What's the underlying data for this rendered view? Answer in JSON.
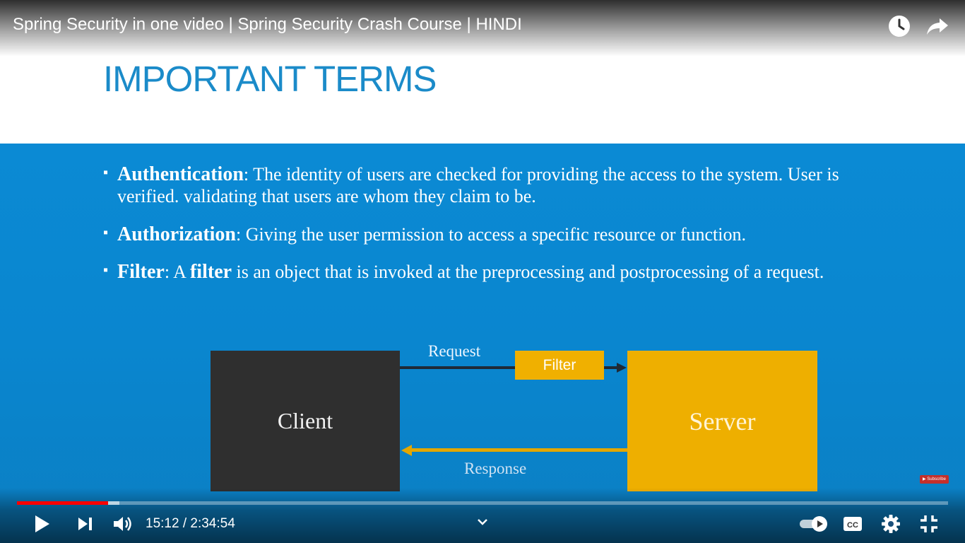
{
  "video": {
    "title": "Spring Security in one video | Spring Security Crash Course | HINDI"
  },
  "slide": {
    "title": "IMPORTANT TERMS",
    "bullets": [
      {
        "term": "Authentication",
        "text": ": The identity of users are checked for providing the access to the system. User is verified.  validating that users are whom they claim to be."
      },
      {
        "term": "Authorization",
        "text": ": Giving the user permission to access a specific resource or function."
      },
      {
        "term": "Filter",
        "text_pre": ": A ",
        "term2": "filter",
        "text": " is an object that is invoked at the preprocessing and postprocessing of a request."
      }
    ],
    "bullet_symbol": "▪",
    "diagram": {
      "client": "Client",
      "server": "Server",
      "filter": "Filter",
      "request": "Request",
      "response": "Response"
    },
    "subscribe_badge": "▶ Subscribe"
  },
  "player": {
    "time_display": "15:12 / 2:34:54",
    "progress_fraction": 0.098,
    "buffered_fraction": 0.11,
    "icons": {
      "watch_later": "clock-icon",
      "share": "share-arrow-icon",
      "play": "play-icon",
      "next": "next-icon",
      "volume": "volume-icon",
      "chevron": "chevron-down-icon",
      "autoplay": "autoplay-toggle-icon",
      "cc": "cc-icon",
      "settings": "gear-icon",
      "exit_fullscreen": "exit-fullscreen-icon"
    },
    "colors": {
      "progress_played": "#ff0000",
      "slide_blue": "#0a86cf",
      "server_yellow": "#eeaf00",
      "client_dark": "#2f2f2f"
    }
  }
}
